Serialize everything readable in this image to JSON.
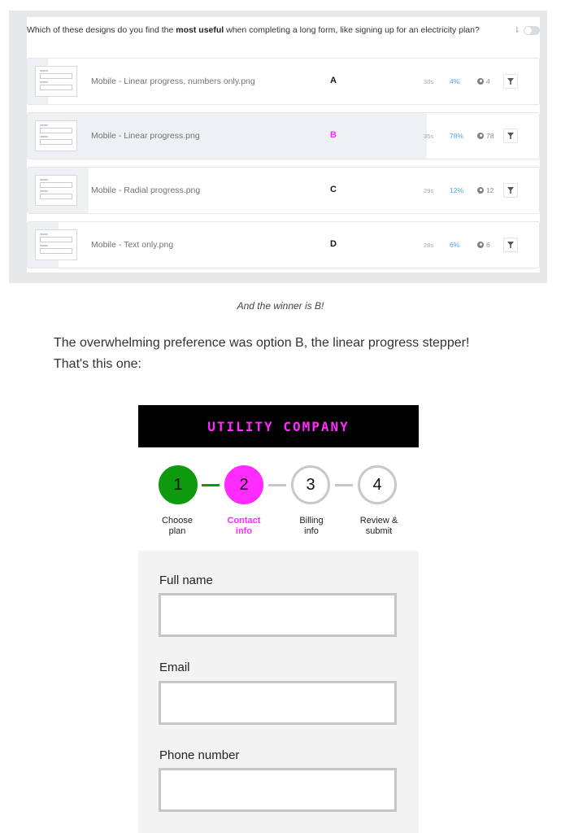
{
  "survey": {
    "question_pre": "Which of these designs do you find the ",
    "question_bold": "most useful",
    "question_post": " when completing a long form, like signing up for an electricity plan?",
    "sort_icon": "sort-icon",
    "options": [
      {
        "file": "Mobile - Linear progress, numbers only.png",
        "letter": "A",
        "time": "38s",
        "percent": "4%",
        "count": "4",
        "share": 0.04,
        "letter_color": "#111111"
      },
      {
        "file": "Mobile - Linear progress.png",
        "letter": "B",
        "time": "35s",
        "percent": "78%",
        "count": "78",
        "share": 0.78,
        "letter_color": "#ff2bff"
      },
      {
        "file": "Mobile - Radial progress.png",
        "letter": "C",
        "time": "29s",
        "percent": "12%",
        "count": "12",
        "share": 0.12,
        "letter_color": "#111111"
      },
      {
        "file": "Mobile - Text only.png",
        "letter": "D",
        "time": "28s",
        "percent": "6%",
        "count": "6",
        "share": 0.06,
        "letter_color": "#111111"
      }
    ]
  },
  "caption": "And the winner is B!",
  "paragraph": "The overwhelming preference was option B, the linear progress stepper! That's this one:",
  "mock": {
    "brand": "UTILITY COMPANY",
    "steps": [
      {
        "number": "1",
        "label_line1": "Choose",
        "label_line2": "plan",
        "state": "done"
      },
      {
        "number": "2",
        "label_line1": "Contact",
        "label_line2": "info",
        "state": "active"
      },
      {
        "number": "3",
        "label_line1": "Billing",
        "label_line2": "info",
        "state": "todo"
      },
      {
        "number": "4",
        "label_line1": "Review &",
        "label_line2": "submit",
        "state": "todo"
      }
    ],
    "fields": [
      {
        "label": "Full name",
        "value": ""
      },
      {
        "label": "Email",
        "value": ""
      },
      {
        "label": "Phone number",
        "value": ""
      }
    ]
  },
  "colors": {
    "accent": "#ff2bff",
    "done": "#0e9a0e",
    "link_blue": "#4aa3f0"
  }
}
